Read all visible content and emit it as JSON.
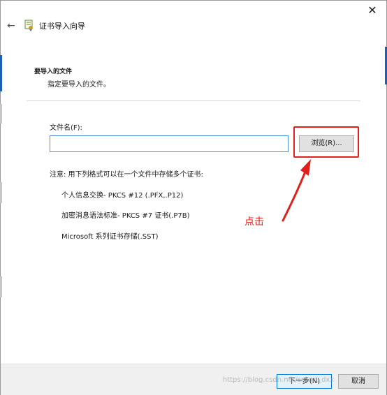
{
  "window": {
    "close_glyph": "✕",
    "back_icon": "back-arrow-icon",
    "app_icon": "certificate-icon",
    "title": "证书导入向导"
  },
  "section": {
    "title": "要导入的文件",
    "description": "指定要导入的文件。"
  },
  "file": {
    "label": "文件名(F):",
    "value": "",
    "browse_label": "浏览(R)..."
  },
  "formats": {
    "note": "注意: 用下列格式可以在一个文件中存储多个证书:",
    "items": [
      "个人信息交换- PKCS #12 (.PFX,.P12)",
      "加密消息语法标准- PKCS #7 证书(.P7B)",
      "Microsoft 系列证书存储(.SST)"
    ]
  },
  "annotation": {
    "text": "点击",
    "color": "#e0201d"
  },
  "footer": {
    "next_label": "下一步(N)",
    "cancel_label": "取消"
  },
  "watermark": "https://blog.csdn.net/smart_dxx",
  "colors": {
    "accent": "#0078d7",
    "highlight": "#e0201d"
  }
}
